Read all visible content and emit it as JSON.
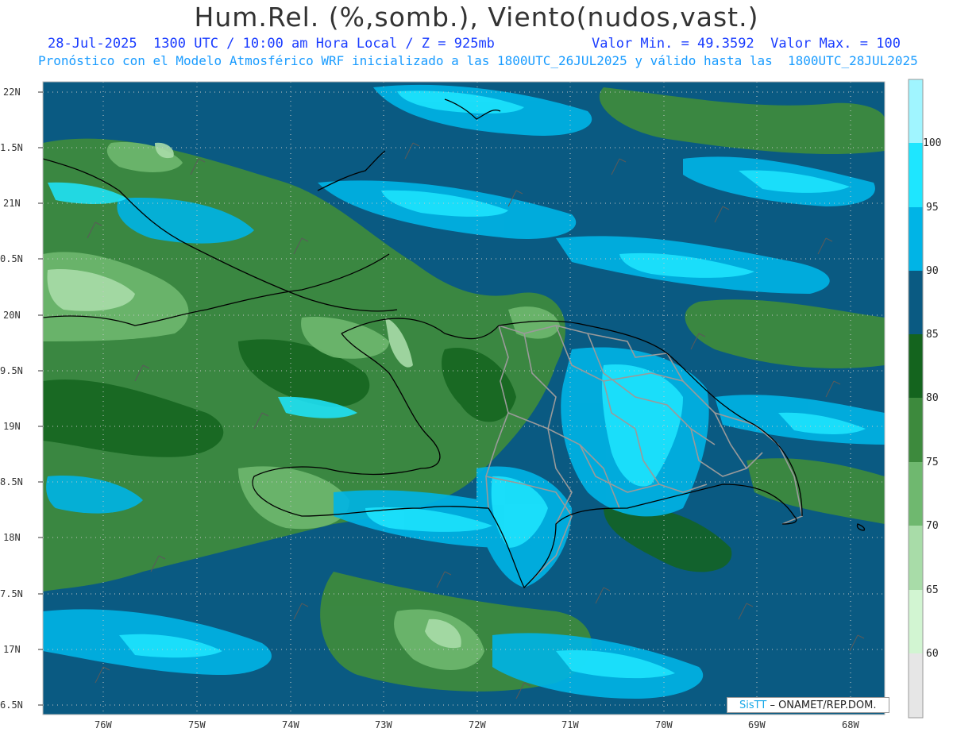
{
  "header": {
    "title": "Hum.Rel. (%,somb.), Viento(nudos,vast.)",
    "subtitle_left": "28-Jul-2025  1300 UTC / 10:00 am Hora Local / Z = 925mb",
    "subtitle_right": "Valor Min. = 49.3592  Valor Max. = 100",
    "subtitle_line2": "Pronóstico con el Modelo Atmosférico WRF inicializado a las 1800UTC_26JUL2025 y válido hasta las  1800UTC_28JUL2025"
  },
  "map": {
    "lat_labels": [
      "22N",
      "1.5N",
      "21N",
      "0.5N",
      "20N",
      "9.5N",
      "19N",
      "8.5N",
      "18N",
      "7.5N",
      "17N",
      "6.5N"
    ],
    "lon_labels": [
      "76W",
      "75W",
      "74W",
      "73W",
      "72W",
      "71W",
      "70W",
      "69W",
      "68W"
    ],
    "colorbar": {
      "levels": [
        "60",
        "65",
        "70",
        "75",
        "80",
        "85",
        "90",
        "95",
        "100"
      ],
      "colors": [
        "#e6e6e6",
        "#d2f5d2",
        "#a8dca8",
        "#6fb86f",
        "#3d8a3d",
        "#14641e",
        "#0a5a82",
        "#00b4e6",
        "#1ee6ff",
        "#a0f5ff"
      ]
    },
    "palette": {
      "background": "#0a5a82",
      "coast": "#000000",
      "provinces": "#9a9a9a",
      "gridlines": "#bfbfbf"
    },
    "credit_brand": "SisTT",
    "credit_org": "– ONAMET/REP.DOM."
  }
}
